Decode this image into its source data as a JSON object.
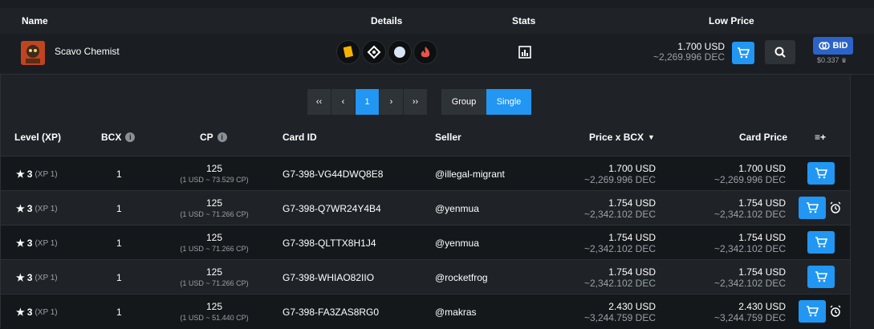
{
  "market": {
    "headers": {
      "name": "Name",
      "details": "Details",
      "stats": "Stats",
      "low_price": "Low Price"
    },
    "card": {
      "name": "Scavo Chemist",
      "detail_icons": [
        "rarity-icon",
        "element-icon",
        "edition-icon",
        "foil-icon"
      ],
      "stats_icon": "stats-icon",
      "low_price_usd": "1.700 USD",
      "low_price_dec": "~2,269.996 DEC",
      "bid_label": "BID",
      "bid_price": "$0.337"
    }
  },
  "pager": {
    "first": "‹‹",
    "prev": "‹",
    "current": "1",
    "next": "›",
    "last": "››",
    "group_label": "Group",
    "single_label": "Single",
    "active_view": "Single"
  },
  "table": {
    "headers": {
      "level": "Level (XP)",
      "bcx": "BCX",
      "cp": "CP",
      "card_id": "Card ID",
      "seller": "Seller",
      "price_bcx": "Price x BCX",
      "card_price": "Card Price",
      "add_all": "≡+"
    },
    "rows": [
      {
        "level": "3",
        "xp": "(XP 1)",
        "bcx": "1",
        "cp": "125",
        "cp_rate": "(1 USD ~ 73.529 CP)",
        "card_id": "G7-398-VG44DWQ8E8",
        "seller": "@illegal-migrant",
        "price_usd": "1.700 USD",
        "price_dec": "~2,269.996 DEC",
        "card_usd": "1.700 USD",
        "card_dec": "~2,269.996 DEC"
      },
      {
        "level": "3",
        "xp": "(XP 1)",
        "bcx": "1",
        "cp": "125",
        "cp_rate": "(1 USD ~ 71.266 CP)",
        "card_id": "G7-398-Q7WR24Y4B4",
        "seller": "@yenmua",
        "price_usd": "1.754 USD",
        "price_dec": "~2,342.102 DEC",
        "card_usd": "1.754 USD",
        "card_dec": "~2,342.102 DEC"
      },
      {
        "level": "3",
        "xp": "(XP 1)",
        "bcx": "1",
        "cp": "125",
        "cp_rate": "(1 USD ~ 71.266 CP)",
        "card_id": "G7-398-QLTTX8H1J4",
        "seller": "@yenmua",
        "price_usd": "1.754 USD",
        "price_dec": "~2,342.102 DEC",
        "card_usd": "1.754 USD",
        "card_dec": "~2,342.102 DEC"
      },
      {
        "level": "3",
        "xp": "(XP 1)",
        "bcx": "1",
        "cp": "125",
        "cp_rate": "(1 USD ~ 71.266 CP)",
        "card_id": "G7-398-WHIAO82IIO",
        "seller": "@rocketfrog",
        "price_usd": "1.754 USD",
        "price_dec": "~2,342.102 DEC",
        "card_usd": "1.754 USD",
        "card_dec": "~2,342.102 DEC"
      },
      {
        "level": "3",
        "xp": "(XP 1)",
        "bcx": "1",
        "cp": "125",
        "cp_rate": "(1 USD ~ 51.440 CP)",
        "card_id": "G7-398-FA3ZAS8RG0",
        "seller": "@makras",
        "price_usd": "2.430 USD",
        "price_dec": "~3,244.759 DEC",
        "card_usd": "2.430 USD",
        "card_dec": "~3,244.759 DEC"
      }
    ]
  },
  "colors": {
    "accent": "#2196f3",
    "bid": "#2b63c9",
    "background": "#1a1d21",
    "panel": "#1f2327"
  }
}
